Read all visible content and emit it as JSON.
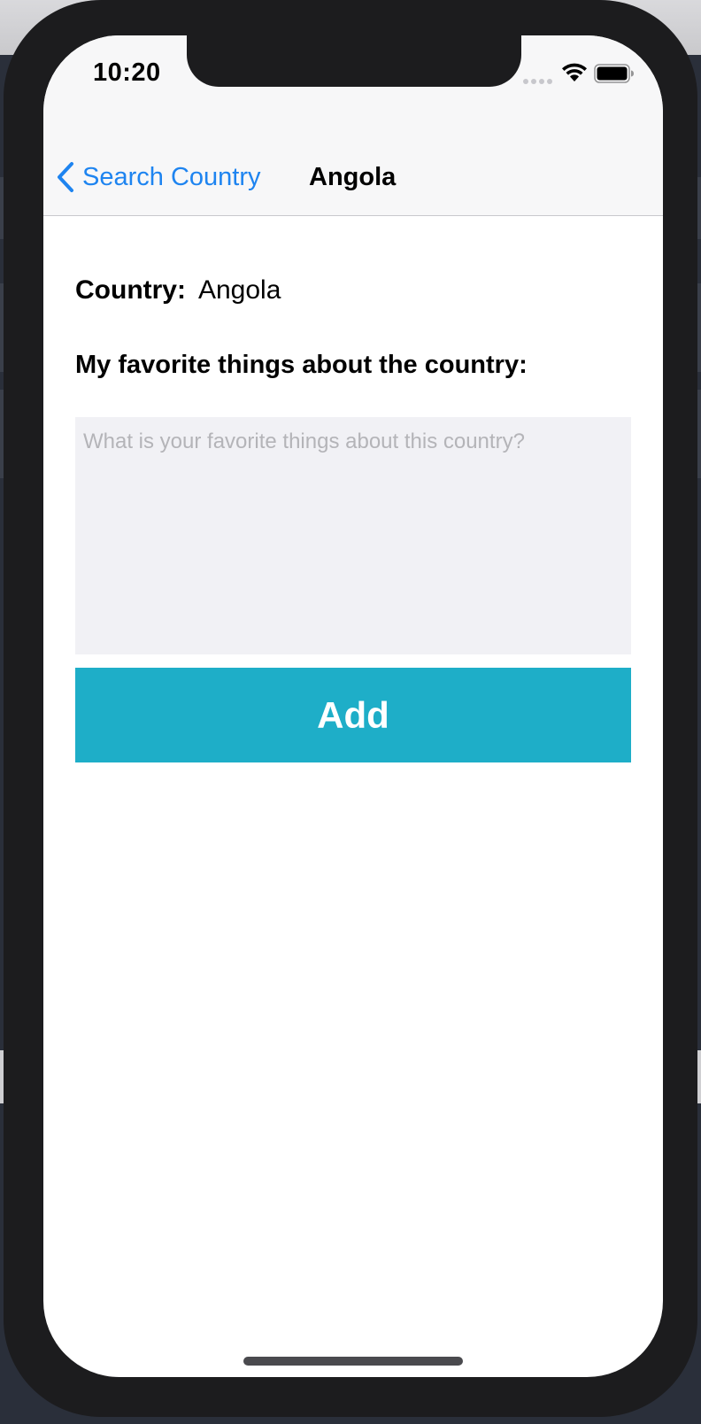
{
  "status_bar": {
    "time": "10:20"
  },
  "nav": {
    "back_label": "Search Country",
    "title": "Angola"
  },
  "form": {
    "country_label": "Country:",
    "country_value": "Angola",
    "favorites_label": "My favorite things about the country:",
    "favorites_placeholder": "What is your favorite things about this country?",
    "favorites_value": "",
    "add_label": "Add"
  },
  "colors": {
    "accent_blue": "#1e84f0",
    "add_button": "#1eaec8",
    "input_background": "#f1f1f5"
  }
}
